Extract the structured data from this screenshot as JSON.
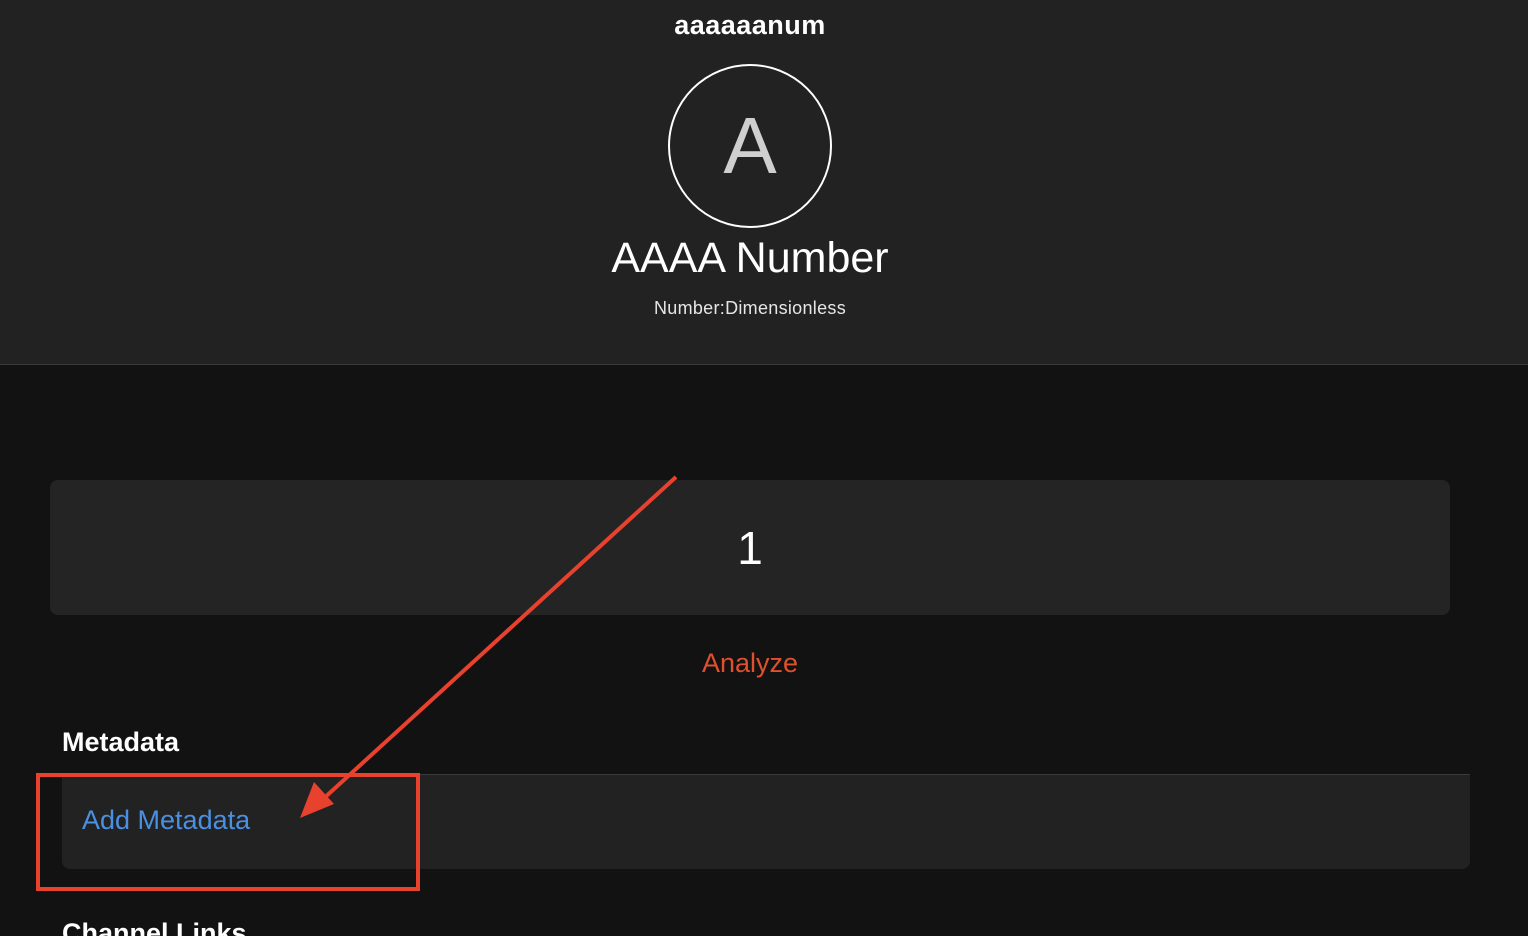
{
  "item": {
    "name": "aaaaaanum",
    "avatar_letter": "A",
    "label": "AAAA Number",
    "type": "Number:Dimensionless",
    "state": "1"
  },
  "actions": {
    "analyze_label": "Analyze"
  },
  "metadata": {
    "section_title": "Metadata",
    "add_label": "Add Metadata"
  },
  "next_section": {
    "title": "Channel Links"
  },
  "colors": {
    "header_bg": "#222222",
    "page_bg": "#121212",
    "accent_orange": "#e0502e",
    "link_blue": "#4a90e2",
    "annotation_red": "#e8412d"
  }
}
